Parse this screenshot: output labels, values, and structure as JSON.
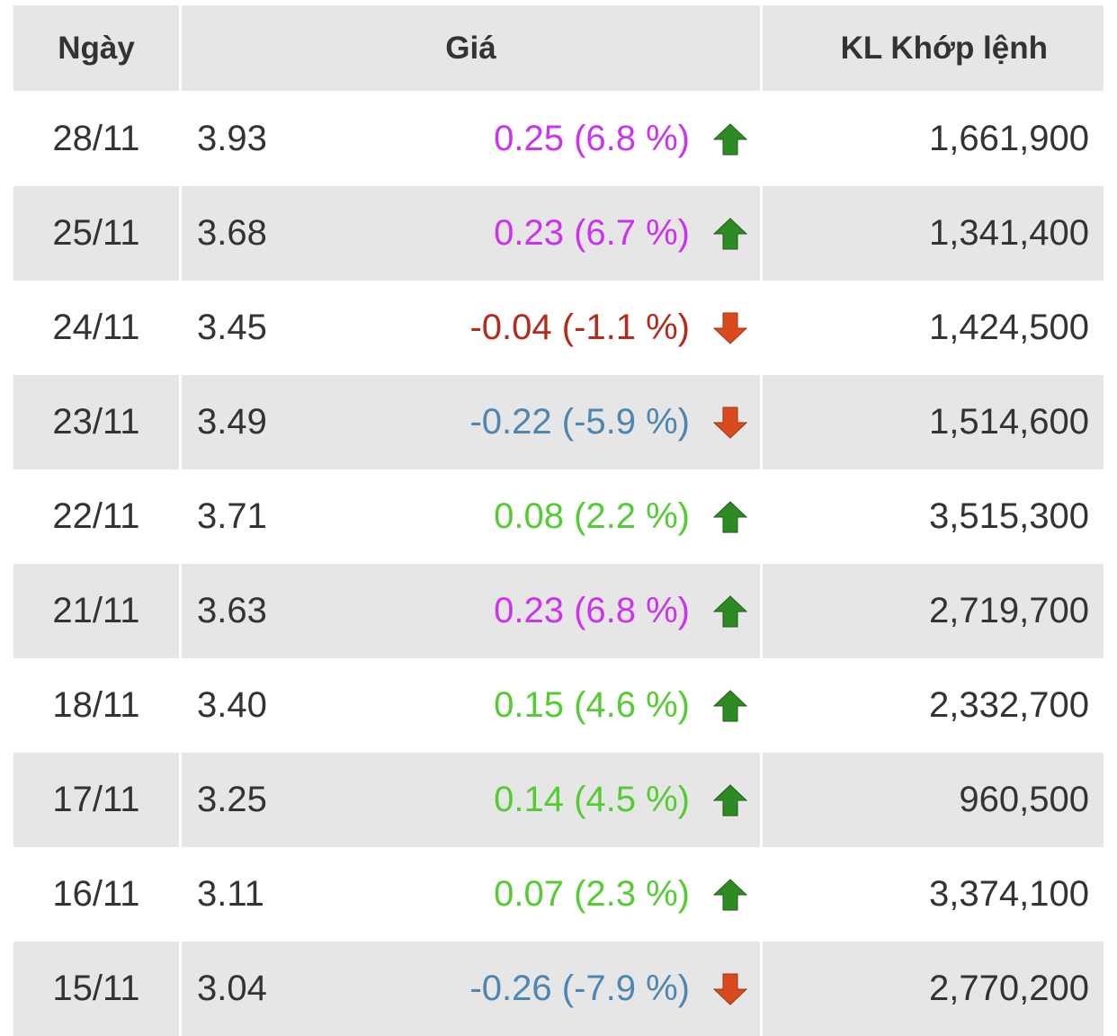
{
  "header": {
    "date": "Ngày",
    "price": "Giá",
    "volume": "KL Khớp lệnh"
  },
  "colors": {
    "ceiling": "#cc33ee",
    "up": "#55cc33",
    "down": "#b52a1b",
    "floor": "#4d86b0",
    "arrow_up": "#2e8b24",
    "arrow_down": "#d94a1f"
  },
  "rows": [
    {
      "date": "28/11",
      "close": "3.93",
      "change": "0.25 (6.8 %)",
      "status": "ceiling",
      "direction": "up",
      "volume": "1,661,900"
    },
    {
      "date": "25/11",
      "close": "3.68",
      "change": "0.23 (6.7 %)",
      "status": "ceiling",
      "direction": "up",
      "volume": "1,341,400"
    },
    {
      "date": "24/11",
      "close": "3.45",
      "change": "-0.04 (-1.1 %)",
      "status": "down",
      "direction": "down",
      "volume": "1,424,500"
    },
    {
      "date": "23/11",
      "close": "3.49",
      "change": "-0.22 (-5.9 %)",
      "status": "floor",
      "direction": "down",
      "volume": "1,514,600"
    },
    {
      "date": "22/11",
      "close": "3.71",
      "change": "0.08 (2.2 %)",
      "status": "up",
      "direction": "up",
      "volume": "3,515,300"
    },
    {
      "date": "21/11",
      "close": "3.63",
      "change": "0.23 (6.8 %)",
      "status": "ceiling",
      "direction": "up",
      "volume": "2,719,700"
    },
    {
      "date": "18/11",
      "close": "3.40",
      "change": "0.15 (4.6 %)",
      "status": "up",
      "direction": "up",
      "volume": "2,332,700"
    },
    {
      "date": "17/11",
      "close": "3.25",
      "change": "0.14 (4.5 %)",
      "status": "up",
      "direction": "up",
      "volume": "960,500"
    },
    {
      "date": "16/11",
      "close": "3.11",
      "change": "0.07 (2.3 %)",
      "status": "up",
      "direction": "up",
      "volume": "3,374,100"
    },
    {
      "date": "15/11",
      "close": "3.04",
      "change": "-0.26 (-7.9 %)",
      "status": "floor",
      "direction": "down",
      "volume": "2,770,200"
    }
  ]
}
